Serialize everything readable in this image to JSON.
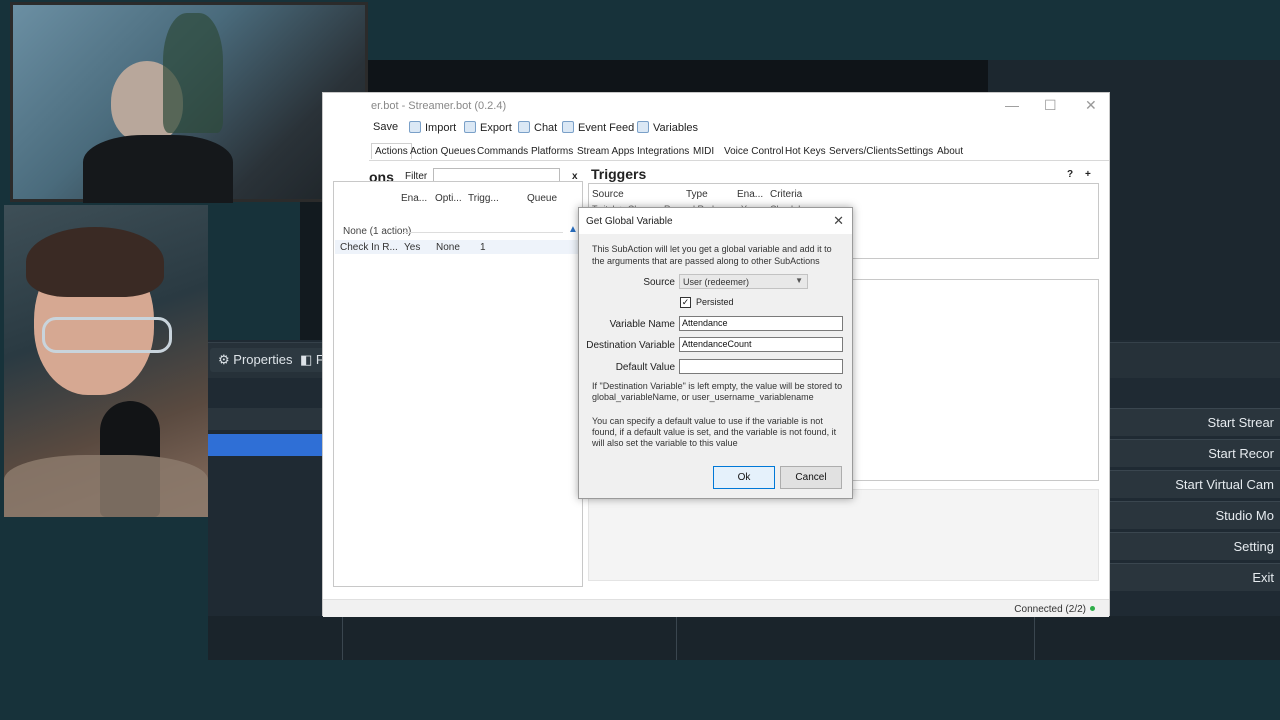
{
  "obs": {
    "tab_properties": "Properties",
    "tab_filters": "F",
    "controls": [
      "Start Strear",
      "Start Recor",
      "Start Virtual Cam",
      "Studio Mo",
      "Setting",
      "Exit"
    ]
  },
  "streamerbot": {
    "window_title": "er.bot - Streamer.bot (0.2.4)",
    "toolbar": {
      "save": "Save",
      "import": "Import",
      "export": "Export",
      "chat": "Chat",
      "event_feed": "Event Feed",
      "variables": "Variables"
    },
    "tabs": [
      "Actions",
      "Action Queues",
      "Commands",
      "Platforms",
      "Stream Apps",
      "Integrations",
      "MIDI",
      "Voice Control",
      "Hot Keys",
      "Servers/Clients",
      "Settings",
      "About"
    ],
    "actions": {
      "heading": "ons",
      "filter_label": "Filter",
      "filter_value": "",
      "clear": "x",
      "columns": [
        "Ena...",
        "Opti...",
        "Trigg...",
        "Queue"
      ],
      "group": "None (1 action)",
      "rows": [
        {
          "name": "Check In R...",
          "enabled": "Yes",
          "queue": "None",
          "triggers": "1"
        }
      ]
    },
    "triggers": {
      "heading": "Triggers",
      "help": "?",
      "add": "+",
      "columns": [
        "Source",
        "Type",
        "Ena...",
        "Criteria"
      ],
      "rows": [
        {
          "source": "Twitch > Chan...",
          "type": "Reward Rede...",
          "enabled": "Yes",
          "criteria": "Check In"
        }
      ]
    },
    "status": "Connected (2/2)"
  },
  "dialog": {
    "title": "Get Global Variable",
    "description": "This SubAction will let you get a global variable and add it to the arguments that are passed along to other SubActions",
    "source_label": "Source",
    "source_value": "User (redeemer)",
    "persisted_label": "Persisted",
    "persisted_checked": true,
    "variable_name_label": "Variable Name",
    "variable_name_value": "Attendance",
    "destination_label": "Destination Variable",
    "destination_value": "AttendanceCount",
    "default_label": "Default Value",
    "default_value": "",
    "note1": "If \"Destination Variable\" is left empty, the value will be stored to global_variableName, or user_username_variablename",
    "note2": "You can specify a default value to use if the variable is not found, if a default value is set, and the variable is not found, it will also set the variable to this value",
    "ok": "Ok",
    "cancel": "Cancel"
  }
}
